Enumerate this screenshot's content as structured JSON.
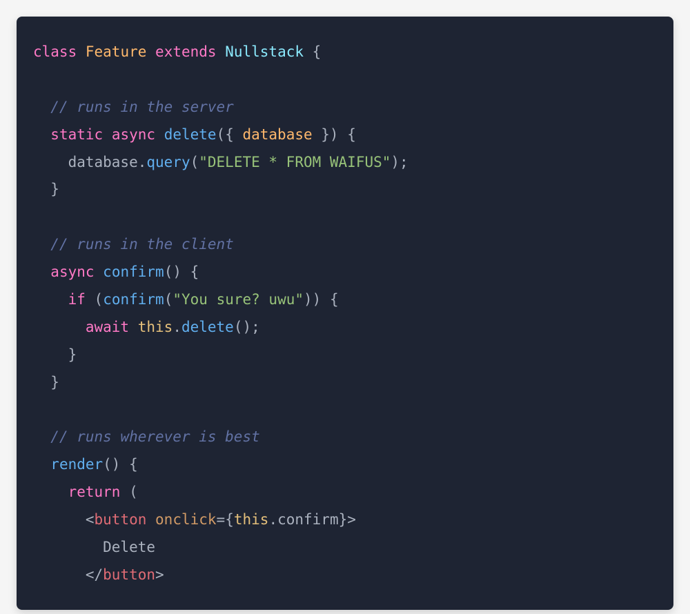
{
  "code": {
    "tokens": [
      {
        "cls": "tok-keyword",
        "t": "class"
      },
      {
        "cls": "tok-default",
        "t": " "
      },
      {
        "cls": "tok-class",
        "t": "Feature"
      },
      {
        "cls": "tok-default",
        "t": " "
      },
      {
        "cls": "tok-keyword",
        "t": "extends"
      },
      {
        "cls": "tok-default",
        "t": " "
      },
      {
        "cls": "tok-class2",
        "t": "Nullstack"
      },
      {
        "cls": "tok-default",
        "t": " "
      },
      {
        "cls": "tok-punct",
        "t": "{"
      },
      {
        "cls": "br",
        "t": ""
      },
      {
        "cls": "br",
        "t": ""
      },
      {
        "cls": "tok-default",
        "t": "  "
      },
      {
        "cls": "tok-comment",
        "t": "// runs in the server"
      },
      {
        "cls": "br",
        "t": ""
      },
      {
        "cls": "tok-default",
        "t": "  "
      },
      {
        "cls": "tok-keyword",
        "t": "static"
      },
      {
        "cls": "tok-default",
        "t": " "
      },
      {
        "cls": "tok-keyword",
        "t": "async"
      },
      {
        "cls": "tok-default",
        "t": " "
      },
      {
        "cls": "tok-function",
        "t": "delete"
      },
      {
        "cls": "tok-punct",
        "t": "({ "
      },
      {
        "cls": "tok-param",
        "t": "database"
      },
      {
        "cls": "tok-punct",
        "t": " }) {"
      },
      {
        "cls": "br",
        "t": ""
      },
      {
        "cls": "tok-default",
        "t": "    database"
      },
      {
        "cls": "tok-punct",
        "t": "."
      },
      {
        "cls": "tok-method",
        "t": "query"
      },
      {
        "cls": "tok-punct",
        "t": "("
      },
      {
        "cls": "tok-string",
        "t": "\"DELETE * FROM WAIFUS\""
      },
      {
        "cls": "tok-punct",
        "t": ");"
      },
      {
        "cls": "br",
        "t": ""
      },
      {
        "cls": "tok-default",
        "t": "  "
      },
      {
        "cls": "tok-punct",
        "t": "}"
      },
      {
        "cls": "br",
        "t": ""
      },
      {
        "cls": "br",
        "t": ""
      },
      {
        "cls": "tok-default",
        "t": "  "
      },
      {
        "cls": "tok-comment",
        "t": "// runs in the client"
      },
      {
        "cls": "br",
        "t": ""
      },
      {
        "cls": "tok-default",
        "t": "  "
      },
      {
        "cls": "tok-keyword",
        "t": "async"
      },
      {
        "cls": "tok-default",
        "t": " "
      },
      {
        "cls": "tok-function",
        "t": "confirm"
      },
      {
        "cls": "tok-punct",
        "t": "() {"
      },
      {
        "cls": "br",
        "t": ""
      },
      {
        "cls": "tok-default",
        "t": "    "
      },
      {
        "cls": "tok-keyword",
        "t": "if"
      },
      {
        "cls": "tok-default",
        "t": " "
      },
      {
        "cls": "tok-punct",
        "t": "("
      },
      {
        "cls": "tok-method",
        "t": "confirm"
      },
      {
        "cls": "tok-punct",
        "t": "("
      },
      {
        "cls": "tok-string",
        "t": "\"You sure? uwu\""
      },
      {
        "cls": "tok-punct",
        "t": ")) {"
      },
      {
        "cls": "br",
        "t": ""
      },
      {
        "cls": "tok-default",
        "t": "      "
      },
      {
        "cls": "tok-keyword",
        "t": "await"
      },
      {
        "cls": "tok-default",
        "t": " "
      },
      {
        "cls": "tok-this",
        "t": "this"
      },
      {
        "cls": "tok-punct",
        "t": "."
      },
      {
        "cls": "tok-method",
        "t": "delete"
      },
      {
        "cls": "tok-punct",
        "t": "();"
      },
      {
        "cls": "br",
        "t": ""
      },
      {
        "cls": "tok-default",
        "t": "    "
      },
      {
        "cls": "tok-punct",
        "t": "}"
      },
      {
        "cls": "br",
        "t": ""
      },
      {
        "cls": "tok-default",
        "t": "  "
      },
      {
        "cls": "tok-punct",
        "t": "}"
      },
      {
        "cls": "br",
        "t": ""
      },
      {
        "cls": "br",
        "t": ""
      },
      {
        "cls": "tok-default",
        "t": "  "
      },
      {
        "cls": "tok-comment",
        "t": "// runs wherever is best"
      },
      {
        "cls": "br",
        "t": ""
      },
      {
        "cls": "tok-default",
        "t": "  "
      },
      {
        "cls": "tok-function",
        "t": "render"
      },
      {
        "cls": "tok-punct",
        "t": "() {"
      },
      {
        "cls": "br",
        "t": ""
      },
      {
        "cls": "tok-default",
        "t": "    "
      },
      {
        "cls": "tok-keyword",
        "t": "return"
      },
      {
        "cls": "tok-default",
        "t": " "
      },
      {
        "cls": "tok-punct",
        "t": "("
      },
      {
        "cls": "br",
        "t": ""
      },
      {
        "cls": "tok-default",
        "t": "      "
      },
      {
        "cls": "tok-punct",
        "t": "<"
      },
      {
        "cls": "tok-tag",
        "t": "button"
      },
      {
        "cls": "tok-default",
        "t": " "
      },
      {
        "cls": "tok-attr",
        "t": "onclick"
      },
      {
        "cls": "tok-punct",
        "t": "="
      },
      {
        "cls": "tok-jsx-expr",
        "t": "{"
      },
      {
        "cls": "tok-this",
        "t": "this"
      },
      {
        "cls": "tok-punct",
        "t": "."
      },
      {
        "cls": "tok-default",
        "t": "confirm"
      },
      {
        "cls": "tok-jsx-expr",
        "t": "}"
      },
      {
        "cls": "tok-punct",
        "t": ">"
      },
      {
        "cls": "br",
        "t": ""
      },
      {
        "cls": "tok-default",
        "t": "        Delete"
      },
      {
        "cls": "br",
        "t": ""
      },
      {
        "cls": "tok-default",
        "t": "      "
      },
      {
        "cls": "tok-punct",
        "t": "</"
      },
      {
        "cls": "tok-tag",
        "t": "button"
      },
      {
        "cls": "tok-punct",
        "t": ">"
      }
    ]
  }
}
